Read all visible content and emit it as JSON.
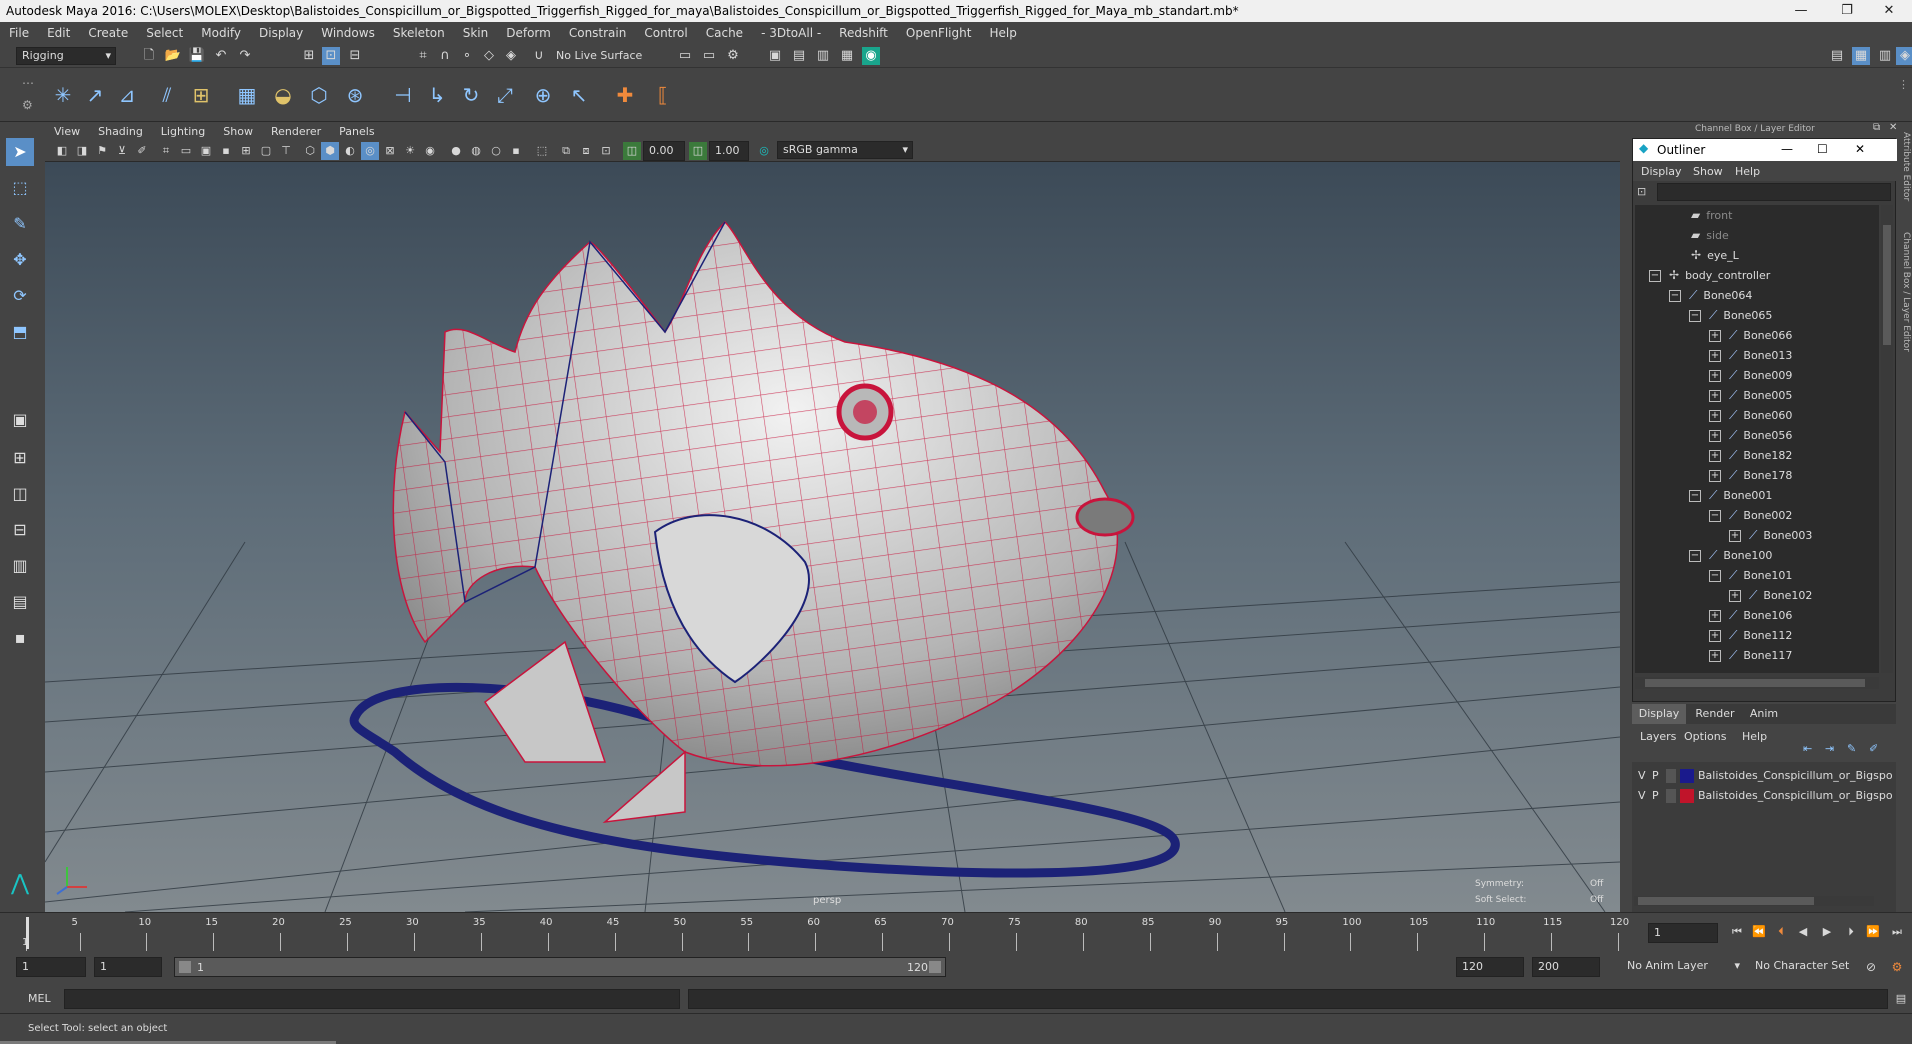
{
  "window": {
    "title": "Autodesk Maya 2016: C:\\Users\\MOLEX\\Desktop\\Balistoides_Conspicillum_or_Bigspotted_Triggerfish_Rigged_for_maya\\Balistoides_Conspicillum_or_Bigspotted_Triggerfish_Rigged_for_Maya_mb_standart.mb*",
    "minimize": "—",
    "restore": "❐",
    "close": "✕"
  },
  "menubar": [
    "File",
    "Edit",
    "Create",
    "Select",
    "Modify",
    "Display",
    "Windows",
    "Skeleton",
    "Skin",
    "Deform",
    "Constrain",
    "Control",
    "Cache",
    "- 3DtoAll -",
    "Redshift",
    "OpenFlight",
    "Help"
  ],
  "statusline": {
    "mode": "Rigging",
    "live_surface": "No Live Surface"
  },
  "viewport": {
    "menus": [
      "View",
      "Shading",
      "Lighting",
      "Show",
      "Renderer",
      "Panels"
    ],
    "exposure": "0.00",
    "gamma": "1.00",
    "color_space": "sRGB gamma",
    "camera_label": "persp",
    "symmetry_label": "Symmetry:",
    "symmetry_value": "Off",
    "soft_select_label": "Soft Select:",
    "soft_select_value": "Off"
  },
  "channel_box": {
    "header": "Channel Box / Layer Editor",
    "side_tab_1": "Attribute Editor",
    "side_tab_2": "Channel Box / Layer Editor"
  },
  "outliner": {
    "title": "Outliner",
    "menus": [
      "Display",
      "Show",
      "Help"
    ],
    "items": [
      {
        "label": "front",
        "depth": 0,
        "expander": "",
        "icon": "camera-icon",
        "dim": true
      },
      {
        "label": "side",
        "depth": 0,
        "expander": "",
        "icon": "camera-icon",
        "dim": true
      },
      {
        "label": "eye_L",
        "depth": 0,
        "expander": "",
        "icon": "controller-icon",
        "dim": false
      },
      {
        "label": "body_controller",
        "depth": 0,
        "expander": "−",
        "icon": "controller-icon",
        "dim": false
      },
      {
        "label": "Bone064",
        "depth": 1,
        "expander": "−",
        "icon": "bone-icon",
        "dim": false
      },
      {
        "label": "Bone065",
        "depth": 2,
        "expander": "−",
        "icon": "bone-icon",
        "dim": false
      },
      {
        "label": "Bone066",
        "depth": 3,
        "expander": "+",
        "icon": "bone-icon",
        "dim": false
      },
      {
        "label": "Bone013",
        "depth": 3,
        "expander": "+",
        "icon": "bone-icon",
        "dim": false
      },
      {
        "label": "Bone009",
        "depth": 3,
        "expander": "+",
        "icon": "bone-icon",
        "dim": false
      },
      {
        "label": "Bone005",
        "depth": 3,
        "expander": "+",
        "icon": "bone-icon",
        "dim": false
      },
      {
        "label": "Bone060",
        "depth": 3,
        "expander": "+",
        "icon": "bone-icon",
        "dim": false
      },
      {
        "label": "Bone056",
        "depth": 3,
        "expander": "+",
        "icon": "bone-icon",
        "dim": false
      },
      {
        "label": "Bone182",
        "depth": 3,
        "expander": "+",
        "icon": "bone-icon",
        "dim": false
      },
      {
        "label": "Bone178",
        "depth": 3,
        "expander": "+",
        "icon": "bone-icon",
        "dim": false
      },
      {
        "label": "Bone001",
        "depth": 2,
        "expander": "−",
        "icon": "bone-icon",
        "dim": false
      },
      {
        "label": "Bone002",
        "depth": 3,
        "expander": "−",
        "icon": "bone-icon",
        "dim": false
      },
      {
        "label": "Bone003",
        "depth": 4,
        "expander": "+",
        "icon": "bone-icon",
        "dim": false
      },
      {
        "label": "Bone100",
        "depth": 2,
        "expander": "−",
        "icon": "bone-icon",
        "dim": false
      },
      {
        "label": "Bone101",
        "depth": 3,
        "expander": "−",
        "icon": "bone-icon",
        "dim": false
      },
      {
        "label": "Bone102",
        "depth": 4,
        "expander": "+",
        "icon": "bone-icon",
        "dim": false
      },
      {
        "label": "Bone106",
        "depth": 3,
        "expander": "+",
        "icon": "bone-icon",
        "dim": false
      },
      {
        "label": "Bone112",
        "depth": 3,
        "expander": "+",
        "icon": "bone-icon",
        "dim": false
      },
      {
        "label": "Bone117",
        "depth": 3,
        "expander": "+",
        "icon": "bone-icon",
        "dim": false
      }
    ]
  },
  "layer_editor": {
    "tabs": [
      "Display",
      "Render",
      "Anim"
    ],
    "menus": [
      "Layers",
      "Options",
      "Help"
    ],
    "layers": [
      {
        "v": "V",
        "p": "P",
        "color": "#1a1a8c",
        "name": "Balistoides_Conspicillum_or_Bigspotted"
      },
      {
        "v": "V",
        "p": "P",
        "color": "#c0142a",
        "name": "Balistoides_Conspicillum_or_Bigspotted"
      }
    ]
  },
  "timeline": {
    "ticks": [
      "1",
      "5",
      "10",
      "15",
      "20",
      "25",
      "30",
      "35",
      "40",
      "45",
      "50",
      "55",
      "60",
      "65",
      "70",
      "75",
      "80",
      "85",
      "90",
      "95",
      "100",
      "105",
      "110",
      "115",
      "120"
    ],
    "current_frame": "1"
  },
  "range": {
    "start": "1",
    "playback_start": "1",
    "slider_start": "1",
    "slider_end": "120",
    "playback_end": "120",
    "end": "200",
    "anim_layer": "No Anim Layer",
    "character_set": "No Character Set"
  },
  "command_line": {
    "label": "MEL"
  },
  "help_line": {
    "text": "Select Tool: select an object"
  }
}
